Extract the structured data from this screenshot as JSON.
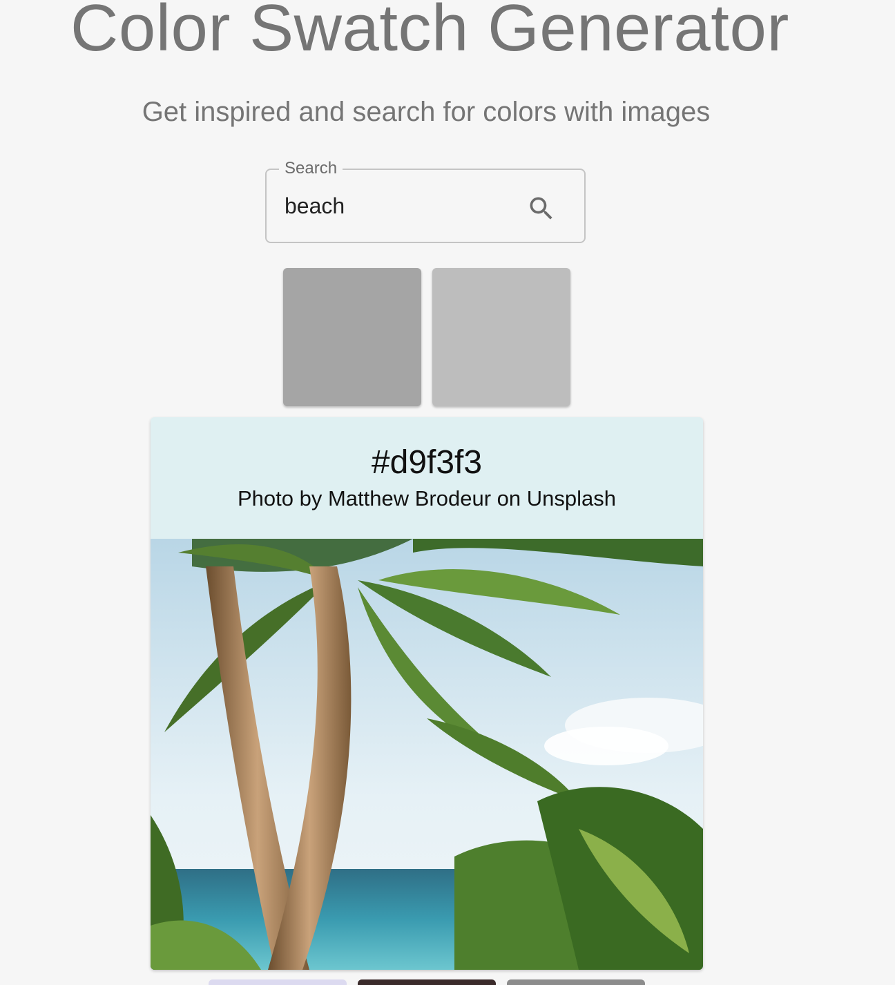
{
  "header": {
    "title": "Color Swatch Generator",
    "subtitle": "Get inspired and search for colors with images"
  },
  "search": {
    "label": "Search",
    "value": "beach",
    "icon": "search-icon"
  },
  "swatches": [
    {
      "color": "#a5a5a5"
    },
    {
      "color": "#bdbdbd"
    }
  ],
  "result_card": {
    "hex": "#d9f3f3",
    "credit": "Photo by Matthew Brodeur on Unsplash",
    "header_color": "#dff0f2"
  },
  "bottom_swatches": [
    {
      "color": "#dcdaf0"
    },
    {
      "color": "#3b2b2b"
    },
    {
      "color": "#8c8c8c"
    }
  ]
}
